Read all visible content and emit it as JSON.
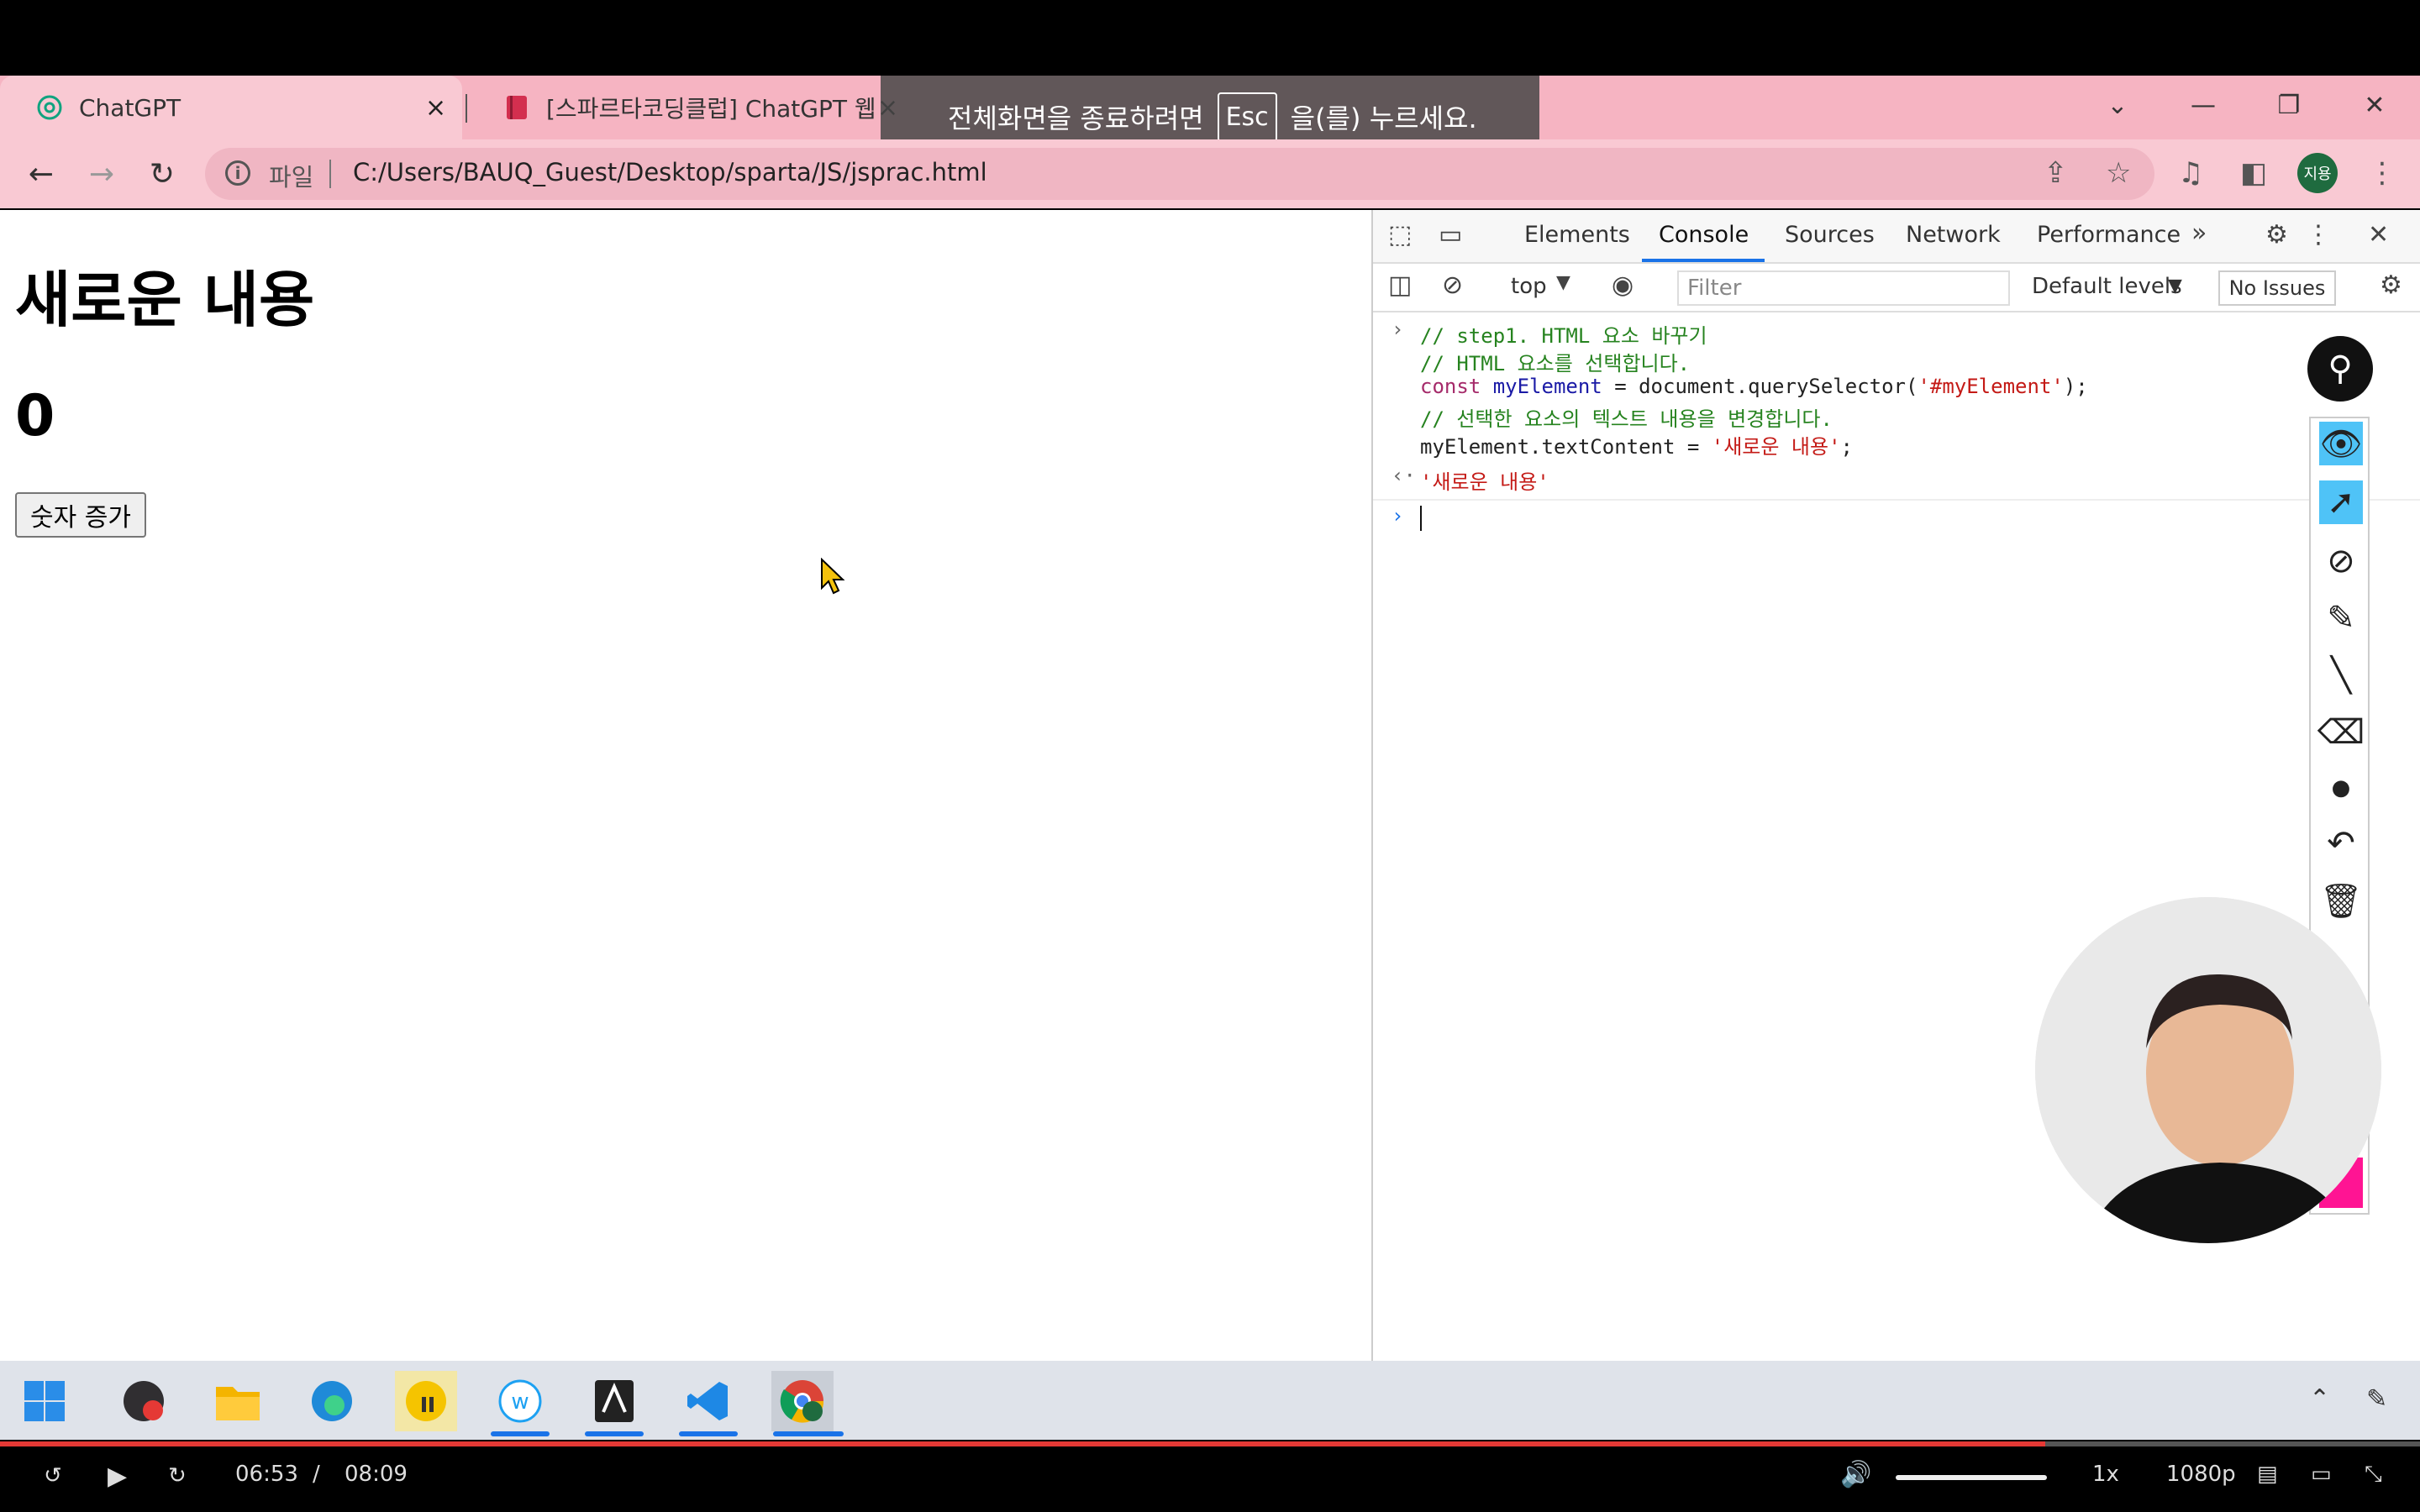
{
  "browser": {
    "tabs": [
      {
        "title": "ChatGPT",
        "close": "×"
      },
      {
        "title": "[스파르타코딩클럽] ChatGPT 웹",
        "close": "×"
      }
    ],
    "url_scheme": "파일",
    "url": "C:/Users/BAUQ_Guest/Desktop/sparta/JS/jsprac.html",
    "profile_initials": "지용",
    "fullscreen_notice": {
      "before": "전체화면을 종료하려면",
      "key": "Esc",
      "after": "을(를) 누르세요."
    }
  },
  "page": {
    "heading": "새로운 내용",
    "counter": "0",
    "button_label": "숫자 증가"
  },
  "devtools": {
    "tabs": [
      "Elements",
      "Console",
      "Sources",
      "Network",
      "Performance"
    ],
    "active_tab": "Console",
    "context": "top",
    "filter_placeholder": "Filter",
    "levels": "Default levels",
    "issues": "No Issues",
    "console": {
      "line1": "// step1. HTML 요소 바꾸기",
      "line2": "// HTML 요소를 선택합니다.",
      "line3_kw": "const",
      "line3_var": "myElement",
      "line3_mid": " = document.querySelector(",
      "line3_str": "'#myElement'",
      "line3_end": ");",
      "line4": "// 선택한 요소의 텍스트 내용을 변경합니다.",
      "line5_pre": "myElement.textContent = ",
      "line5_str": "'새로운 내용'",
      "line5_end": ";",
      "result": "'새로운 내용'"
    }
  },
  "taskbar": {
    "apps": [
      "start",
      "obs",
      "file-explorer",
      "edge",
      "kakaotalk-like",
      "whale",
      "acs",
      "vscode",
      "chrome"
    ]
  },
  "player": {
    "current_time": "06:53",
    "separator": "/",
    "duration": "08:09",
    "speed": "1x",
    "quality": "1080p",
    "progress": 0.845
  }
}
